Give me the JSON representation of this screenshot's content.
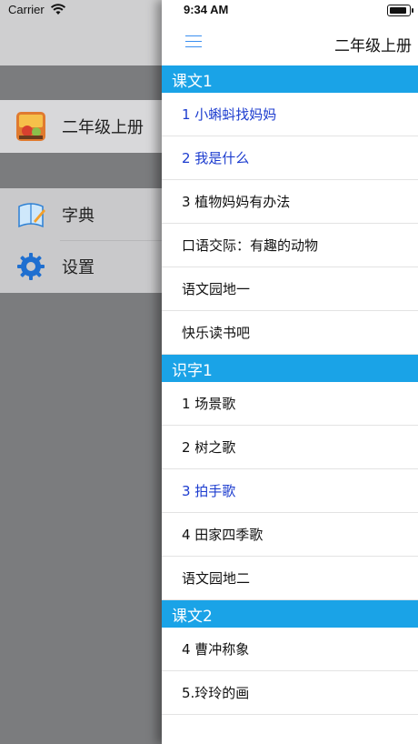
{
  "status": {
    "carrier": "Carrier",
    "time": "9:34 AM"
  },
  "menu": {
    "book": {
      "label": "二年级上册"
    },
    "items": [
      {
        "label": "字典",
        "icon": "dictionary-icon"
      },
      {
        "label": "设置",
        "icon": "gear-icon"
      }
    ]
  },
  "nav": {
    "title": "二年级上册"
  },
  "sections": [
    {
      "title": "课文1",
      "items": [
        {
          "label": "1 小蝌蚪找妈妈",
          "read": true
        },
        {
          "label": "2 我是什么",
          "read": true
        },
        {
          "label": "3 植物妈妈有办法",
          "read": false
        },
        {
          "label": "口语交际：有趣的动物",
          "read": false
        },
        {
          "label": "语文园地一",
          "read": false
        },
        {
          "label": "快乐读书吧",
          "read": false
        }
      ]
    },
    {
      "title": "识字1",
      "items": [
        {
          "label": "1 场景歌",
          "read": false
        },
        {
          "label": "2 树之歌",
          "read": false
        },
        {
          "label": "3 拍手歌",
          "read": true
        },
        {
          "label": "4 田家四季歌",
          "read": false
        },
        {
          "label": "语文园地二",
          "read": false
        }
      ]
    },
    {
      "title": "课文2",
      "items": [
        {
          "label": "4 曹冲称象",
          "read": false
        },
        {
          "label": "5.玲玲的画",
          "read": false
        }
      ]
    }
  ],
  "colors": {
    "section_bg": "#1aa3e7",
    "read_text": "#1c3ccf",
    "accent": "#3b8ff0"
  }
}
